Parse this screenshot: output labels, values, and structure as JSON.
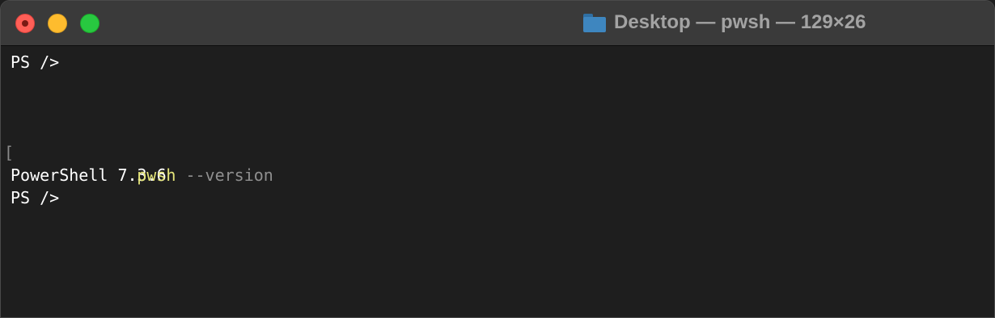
{
  "window": {
    "title": "Desktop — pwsh — 129×26",
    "folder_icon": "folder-icon"
  },
  "colors": {
    "background": "#1e1e1e",
    "titlebar": "#3a3a3a",
    "close": "#ff5f57",
    "minimize": "#febc2e",
    "zoom": "#28c840",
    "command": "#e5e57a",
    "parameter": "#8f8f8f",
    "text": "#ffffff"
  },
  "terminal": {
    "prompt1": "PS />",
    "command_bracket": "[",
    "command_name": "pwsh",
    "command_param": " --version",
    "output": "PowerShell 7.3.6",
    "prompt2": "PS />"
  }
}
